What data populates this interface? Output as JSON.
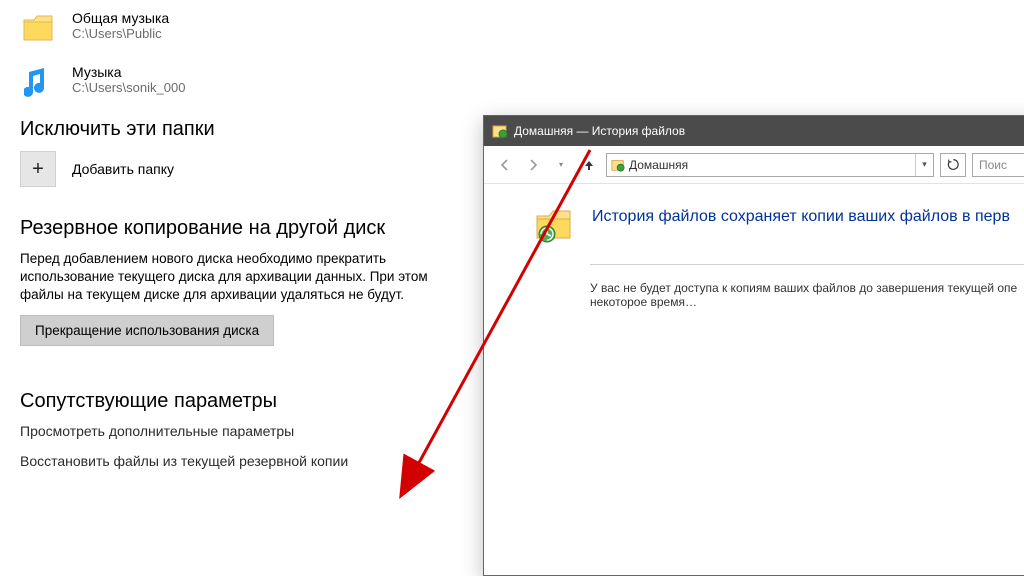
{
  "settings": {
    "folders": [
      {
        "name": "Общая музыка",
        "path": "C:\\Users\\Public"
      },
      {
        "name": "Музыка",
        "path": "C:\\Users\\sonik_000"
      }
    ],
    "exclude": {
      "heading": "Исключить эти папки",
      "addLabel": "Добавить папку"
    },
    "backup": {
      "heading": "Резервное копирование на другой диск",
      "body": "Перед добавлением нового диска необходимо прекратить использование текущего диска для архивации данных. При этом файлы на текущем диске для архивации удаляться не будут.",
      "stopBtn": "Прекращение использования диска"
    },
    "related": {
      "heading": "Сопутствующие параметры",
      "link1": "Просмотреть дополнительные параметры",
      "link2": "Восстановить файлы из текущей резервной копии"
    }
  },
  "fhWindow": {
    "title": "Домашняя — История файлов",
    "address": "Домашняя",
    "searchPlaceholder": "Поис",
    "headline": "История файлов сохраняет копии ваших файлов в перв",
    "body": "У вас не будет доступа к копиям ваших файлов до завершения текущей опе\nнекоторое время…"
  }
}
